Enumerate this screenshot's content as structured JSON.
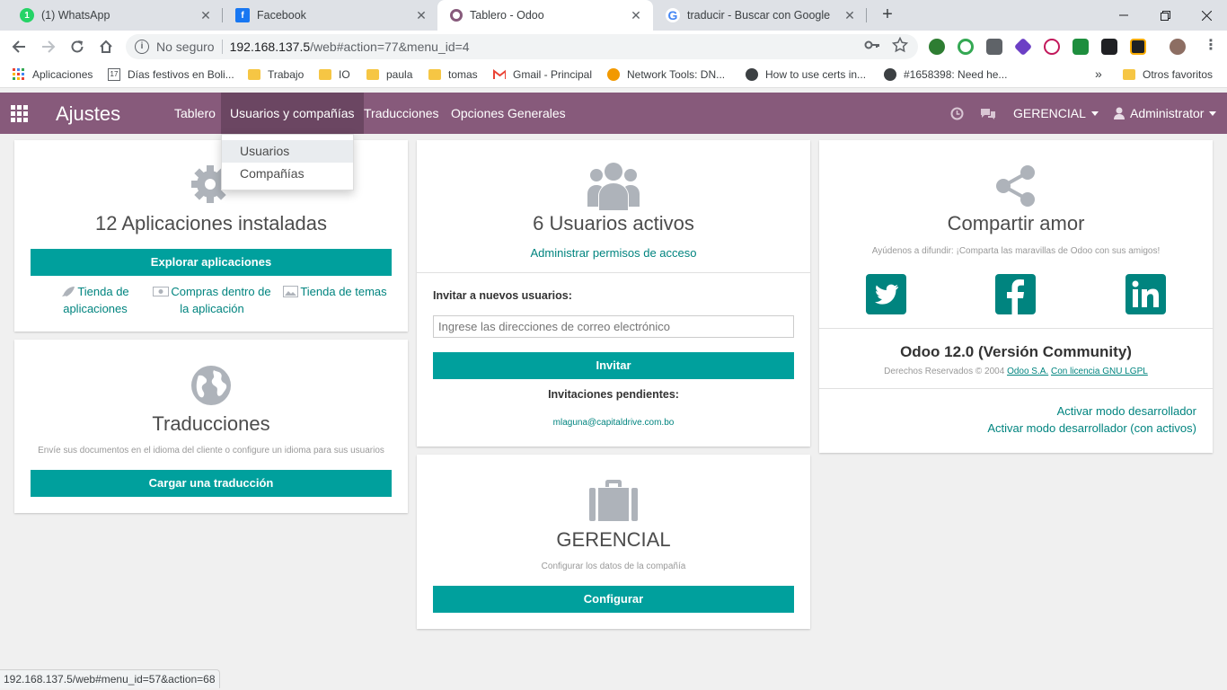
{
  "browser": {
    "tabs": [
      {
        "title": "(1) WhatsApp",
        "favicon": "whatsapp-icon",
        "color": "#25d366"
      },
      {
        "title": "Facebook",
        "favicon": "facebook-icon",
        "color": "#1877f2"
      },
      {
        "title": "Tablero - Odoo",
        "favicon": "odoo-icon",
        "color": "#875a7b"
      },
      {
        "title": "traducir - Buscar con Google",
        "favicon": "google-icon",
        "color": "#4285f4"
      }
    ],
    "tab_close": "✕",
    "new_tab": "+",
    "address": {
      "security": "No seguro",
      "host": "192.168.137.5",
      "path": "/web#action=77&menu_id=4"
    },
    "bookmarks": [
      {
        "label": "Aplicaciones",
        "icon": "apps-grid-icon"
      },
      {
        "label": "Días festivos en Boli...",
        "icon": "calendar-icon"
      },
      {
        "label": "Trabajo",
        "icon": "folder-icon"
      },
      {
        "label": "IO",
        "icon": "folder-icon"
      },
      {
        "label": "paula",
        "icon": "folder-icon"
      },
      {
        "label": "tomas",
        "icon": "folder-icon"
      },
      {
        "label": "Gmail - Principal",
        "icon": "gmail-icon"
      },
      {
        "label": "Network Tools: DN...",
        "icon": "network-tools-icon"
      },
      {
        "label": "How to use certs in...",
        "icon": "github-icon"
      },
      {
        "label": "#1658398: Need he...",
        "icon": "github-icon"
      }
    ],
    "bookmarks_more": "»",
    "other_bookmarks": "Otros favoritos",
    "status_url": "192.168.137.5/web#menu_id=57&action=68"
  },
  "odoo": {
    "brand": "Ajustes",
    "accent": "#875a7b",
    "menu": [
      "Tablero",
      "Usuarios y compañías",
      "Traducciones",
      "Opciones Generales"
    ],
    "dropdown": [
      "Usuarios",
      "Compañías"
    ],
    "company": "GERENCIAL",
    "user": "Administrator"
  },
  "apps_card": {
    "title": "12 Aplicaciones instaladas",
    "button": "Explorar aplicaciones",
    "links": [
      "Tienda de aplicaciones",
      "Compras dentro de la aplicación",
      "Tienda de temas"
    ]
  },
  "translations_card": {
    "title": "Traducciones",
    "subtitle": "Envíe sus documentos en el idioma del cliente o configure un idioma para sus usuarios",
    "button": "Cargar una traducción"
  },
  "users_card": {
    "title": "6 Usuarios activos",
    "manage_link": "Administrar permisos de acceso",
    "invite_label": "Invitar a nuevos usuarios:",
    "invite_placeholder": "Ingrese las direcciones de correo electrónico",
    "invite_button": "Invitar",
    "pending_label": "Invitaciones pendientes:",
    "pending_email": "mlaguna@capitaldrive.com.bo"
  },
  "company_card": {
    "title": "GERENCIAL",
    "subtitle": "Configurar los datos de la compañía",
    "button": "Configurar"
  },
  "share_card": {
    "title": "Compartir amor",
    "subtitle": "Ayúdenos a difundir: ¡Comparta las maravillas de Odoo con sus amigos!",
    "version": "Odoo 12.0 (Versión Community)",
    "copyright": "Derechos Reservados © 2004",
    "odoo_link": "Odoo S.A.",
    "license_link": "Con licencia GNU LGPL",
    "dev_mode": "Activar modo desarrollador",
    "dev_mode_assets": "Activar modo desarrollador (con activos)"
  }
}
